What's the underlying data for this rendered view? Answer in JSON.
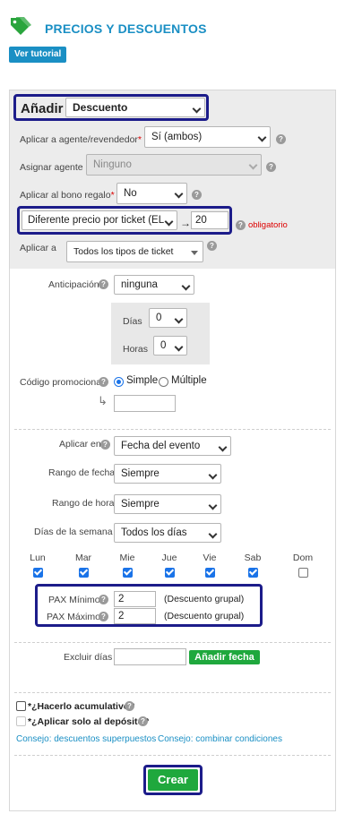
{
  "header": {
    "title": "PRECIOS Y DESCUENTOS",
    "tutorial_label": "Ver tutorial"
  },
  "add": {
    "label": "Añadir",
    "type_value": "Descuento"
  },
  "fields": {
    "agent_label": "Aplicar a agente/revendedor",
    "agent_value": "Sí (ambos)",
    "assign_label": "Asignar agente",
    "assign_value": "Ninguno",
    "gift_label": "Aplicar al bono regalo",
    "gift_value": "No",
    "price_mode_value": "Diferente precio por ticket (EL",
    "price_arrow": "→",
    "price_amount": "20",
    "required_text": "obligatorio",
    "apply_to_label": "Aplicar a",
    "apply_to_value": "Todos los tipos de ticket",
    "anticipation_label": "Anticipación",
    "anticipation_value": "ninguna",
    "days_label": "Días",
    "days_value": "0",
    "hours_label": "Horas",
    "hours_value": "0",
    "promo_label": "Código promocional",
    "promo_simple": "Simple",
    "promo_multiple": "Múltiple",
    "promo_arrow": "↳",
    "promo_code": "",
    "apply_on_label": "Aplicar en",
    "apply_on_value": "Fecha del evento",
    "date_range_label": "Rango de fecha",
    "date_range_value": "Siempre",
    "time_range_label": "Rango de hora",
    "time_range_value": "Siempre",
    "weekdays_label": "Días de la semana",
    "weekdays_value": "Todos los días"
  },
  "weekdays": [
    {
      "label": "Lun",
      "checked": true
    },
    {
      "label": "Mar",
      "checked": true
    },
    {
      "label": "Mie",
      "checked": true
    },
    {
      "label": "Jue",
      "checked": true
    },
    {
      "label": "Vie",
      "checked": true
    },
    {
      "label": "Sab",
      "checked": true
    },
    {
      "label": "Dom",
      "checked": false
    }
  ],
  "pax": {
    "min_label": "PAX Mínimo",
    "min_value": "2",
    "min_note": "(Descuento grupal)",
    "max_label": "PAX Máximo",
    "max_value": "2",
    "max_note": "(Descuento grupal)"
  },
  "exclude": {
    "label": "Excluir días",
    "value": "",
    "button": "Añadir fecha"
  },
  "options": {
    "cumulative": "*¿Hacerlo acumulativo?",
    "deposit_only": "*¿Aplicar solo al depósito?",
    "link_overlap": "Consejo: descuentos superpuestos",
    "link_combine": "Consejo: combinar condiciones"
  },
  "create_label": "Crear",
  "help_glyph": "?",
  "colors": {
    "accent": "#1a8fc4",
    "highlight": "#1c1c8a",
    "green": "#1fa83d",
    "required": "#d00000"
  }
}
